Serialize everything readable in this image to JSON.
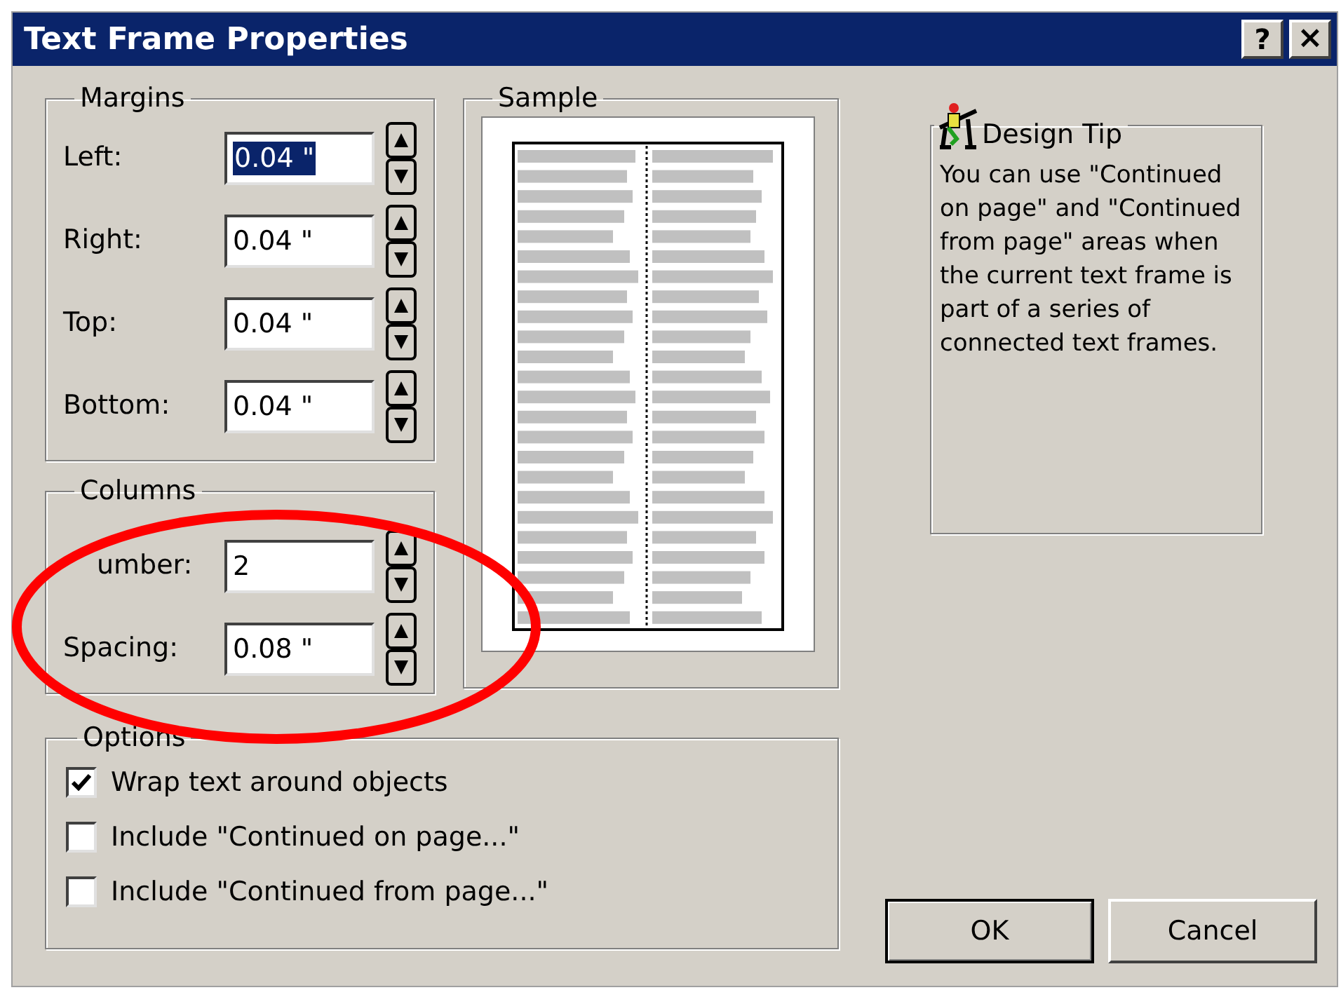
{
  "window": {
    "title": "Text Frame Properties",
    "help_button": "?",
    "close_button": "×"
  },
  "margins": {
    "title": "Margins",
    "fields": [
      {
        "label": "Left:",
        "value": "0.04 \"",
        "selected": true
      },
      {
        "label": "Right:",
        "value": "0.04 \"",
        "selected": false
      },
      {
        "label": "Top:",
        "value": "0.04 \"",
        "selected": false
      },
      {
        "label": "Bottom:",
        "value": "0.04 \"",
        "selected": false
      }
    ]
  },
  "columns": {
    "title": "Columns",
    "fields": [
      {
        "label": "umber:",
        "value": "2",
        "selected": false,
        "kind": "covered"
      },
      {
        "label": "Spacing:",
        "value": "0.08 \"",
        "selected": false
      }
    ]
  },
  "sample": {
    "title": "Sample"
  },
  "design_tip": {
    "title": "Design Tip",
    "text": "You can use \"Continued on page\" and \"Continued from page\" areas when the current text frame is part of a series of connected text frames."
  },
  "options": {
    "title": "Options",
    "items": [
      {
        "label": "Wrap text around objects",
        "checked": true
      },
      {
        "label": "Include \"Continued on page...\"",
        "checked": false
      },
      {
        "label": "Include \"Continued from page...\"",
        "checked": false
      }
    ]
  },
  "buttons": [
    {
      "label": "OK",
      "kind": "default"
    },
    {
      "label": "Cancel",
      "kind": "normal"
    }
  ]
}
